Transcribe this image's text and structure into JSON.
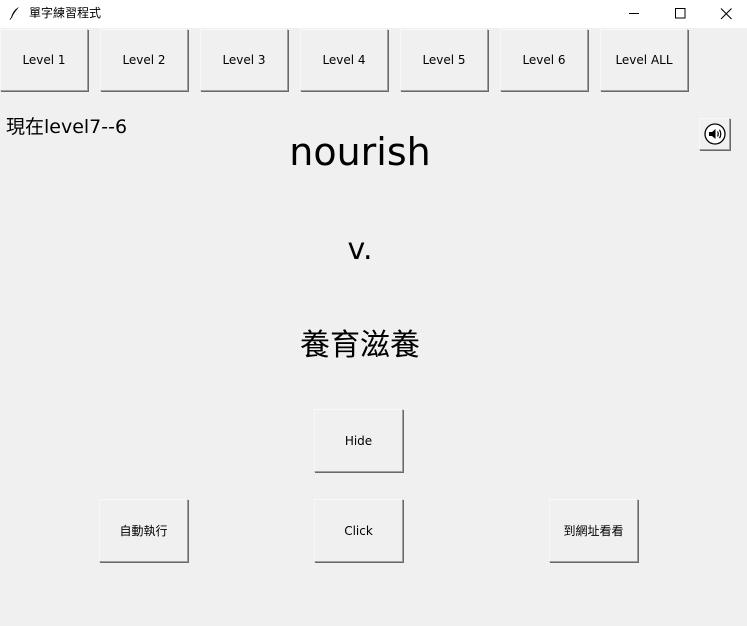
{
  "window": {
    "title": "單字練習程式",
    "app_icon": "feather-icon",
    "controls": [
      "minimize-icon",
      "maximize-icon",
      "close-icon"
    ]
  },
  "level_buttons": [
    {
      "label": "Level 1"
    },
    {
      "label": "Level 2"
    },
    {
      "label": "Level 3"
    },
    {
      "label": "Level 4"
    },
    {
      "label": "Level 5"
    },
    {
      "label": "Level 6"
    },
    {
      "label": "Level ALL"
    }
  ],
  "status": {
    "text": "現在level7--6"
  },
  "card": {
    "word": "nourish",
    "part_of_speech": "v.",
    "meaning": "養育滋養"
  },
  "sound_button": {
    "icon": "speaker-icon"
  },
  "actions": {
    "hide_label": "Hide",
    "auto_label": "自動執行",
    "click_label": "Click",
    "web_label": "到網址看看"
  },
  "colors": {
    "background": "#f0f0f0",
    "titlebar": "#ffffff",
    "text": "#000000"
  }
}
